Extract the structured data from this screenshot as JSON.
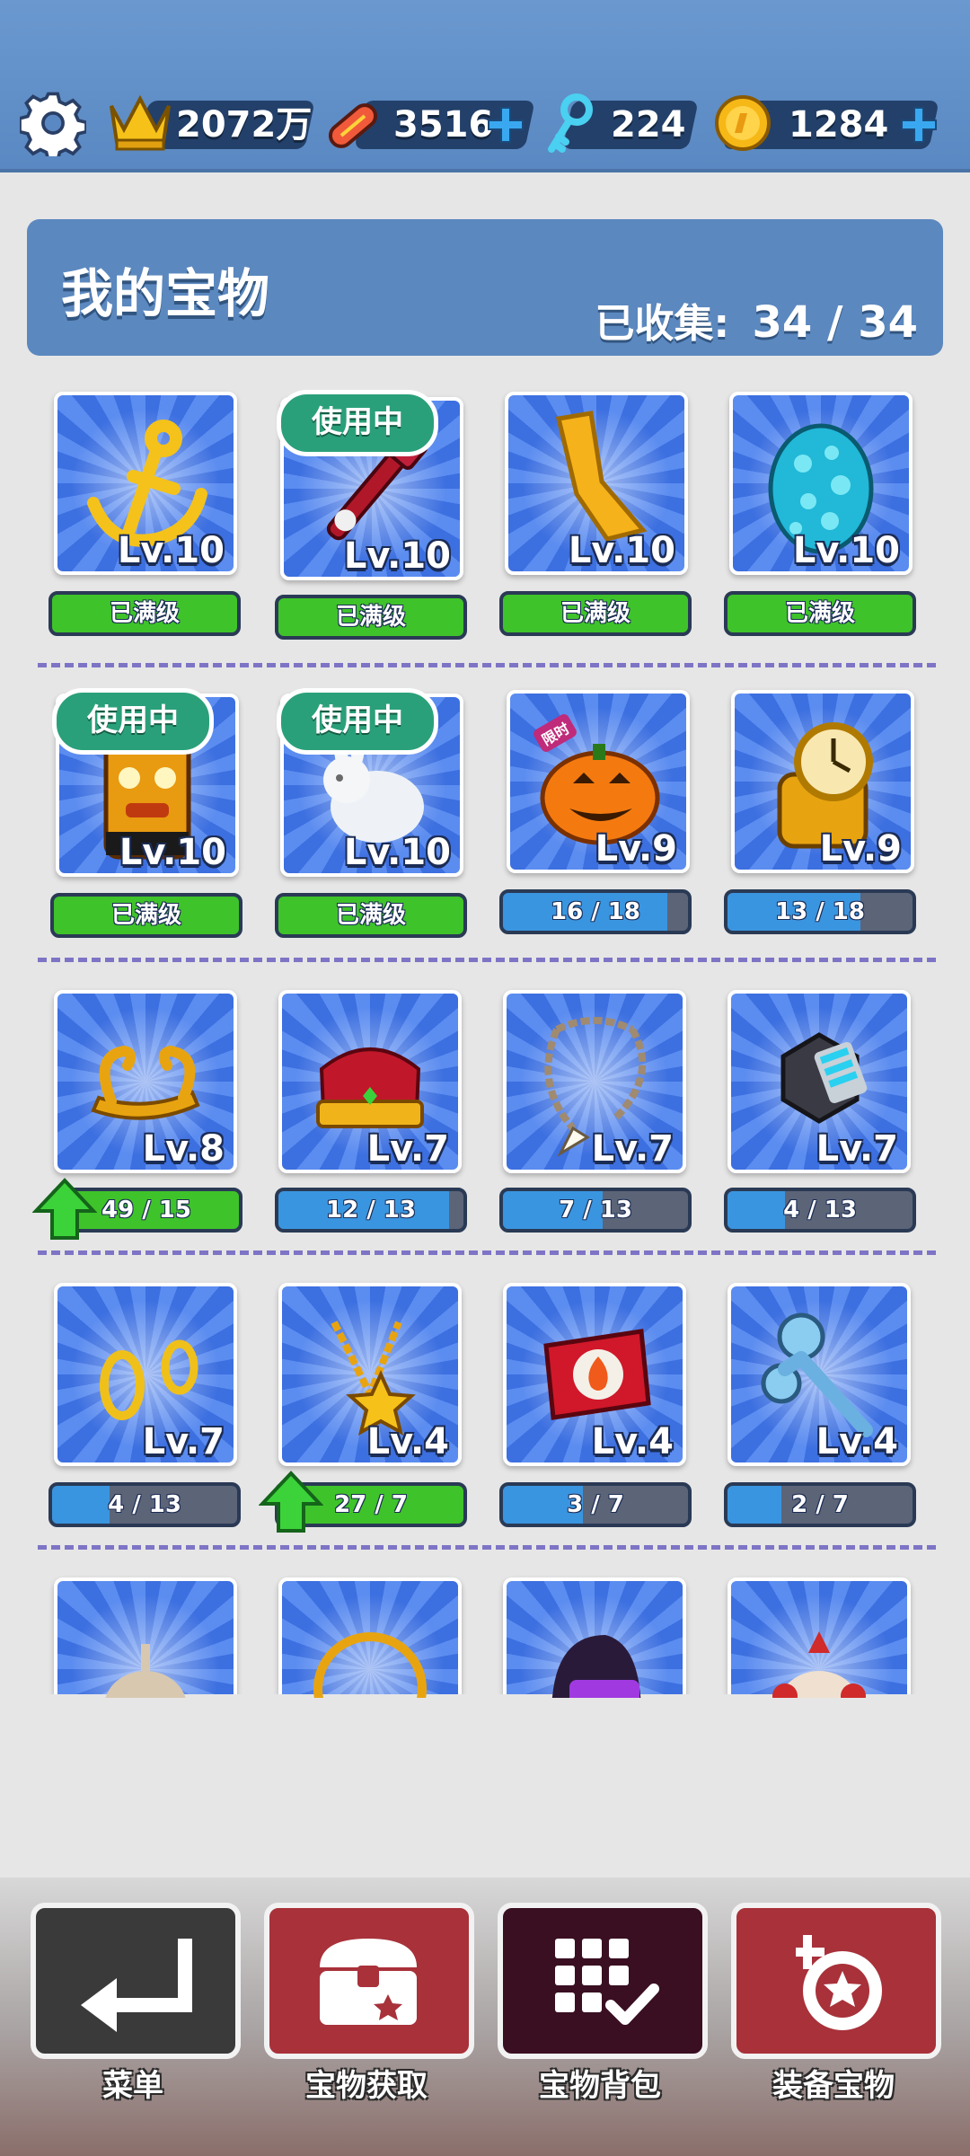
{
  "header": {
    "crowns": "2072万",
    "boards": "3516",
    "keys": "224",
    "coins": "1284"
  },
  "panel": {
    "title": "我的宝物",
    "collected_label": "已收集:",
    "collected_value": "34 / 34"
  },
  "badges": {
    "in_use": "使用中",
    "limited": "限时"
  },
  "treasures": [
    {
      "name": "golden-anchor",
      "level": "Lv.10",
      "progress": "已满级",
      "full": true,
      "in_use": false
    },
    {
      "name": "red-guitar",
      "level": "Lv.10",
      "progress": "已满级",
      "full": true,
      "in_use": true
    },
    {
      "name": "golden-skateboard",
      "level": "Lv.10",
      "progress": "已满级",
      "full": true,
      "in_use": false
    },
    {
      "name": "cyan-egg",
      "level": "Lv.10",
      "progress": "已满级",
      "full": true,
      "in_use": false
    },
    {
      "name": "tiki-mask",
      "level": "Lv.10",
      "progress": "已满级",
      "full": true,
      "in_use": true
    },
    {
      "name": "white-rabbit",
      "level": "Lv.10",
      "progress": "已满级",
      "full": true,
      "in_use": true
    },
    {
      "name": "pumpkin",
      "level": "Lv.9",
      "progress": "16 / 18",
      "fraction": 0.89,
      "full": false,
      "in_use": false
    },
    {
      "name": "gold-watch",
      "level": "Lv.9",
      "progress": "13 / 18",
      "fraction": 0.72,
      "full": false,
      "in_use": false
    },
    {
      "name": "golden-horns",
      "level": "Lv.8",
      "progress": "49 / 15",
      "fraction": 1.0,
      "full": false,
      "upgradable": true
    },
    {
      "name": "crown",
      "level": "Lv.7",
      "progress": "12 / 13",
      "fraction": 0.92,
      "full": false
    },
    {
      "name": "tooth-necklace",
      "level": "Lv.7",
      "progress": "7 / 13",
      "fraction": 0.54,
      "full": false
    },
    {
      "name": "hex-gadget",
      "level": "Lv.7",
      "progress": "4 / 13",
      "fraction": 0.31,
      "full": false
    },
    {
      "name": "gold-earrings",
      "level": "Lv.7",
      "progress": "4 / 13",
      "fraction": 0.31,
      "full": false
    },
    {
      "name": "star-chain",
      "level": "Lv.4",
      "progress": "27 / 7",
      "fraction": 1.0,
      "full": false,
      "upgradable": true
    },
    {
      "name": "fire-box",
      "level": "Lv.4",
      "progress": "3 / 7",
      "fraction": 0.43,
      "full": false
    },
    {
      "name": "wrench",
      "level": "Lv.4",
      "progress": "2 / 7",
      "fraction": 0.29,
      "full": false
    },
    {
      "name": "bag"
    },
    {
      "name": "ring"
    },
    {
      "name": "helmet"
    },
    {
      "name": "clown"
    }
  ],
  "nav": {
    "menu": "菜单",
    "obtain": "宝物获取",
    "backpack": "宝物背包",
    "equip": "装备宝物"
  },
  "colors": {
    "full_bar": "#3fc32a",
    "progress_fill": "#3a95e0",
    "in_use_badge": "#2aa07a",
    "menu_button": "#3a3a3a",
    "obtain_button": "#a8313a",
    "backpack_button": "#3a0f22",
    "equip_button": "#a8313a"
  }
}
